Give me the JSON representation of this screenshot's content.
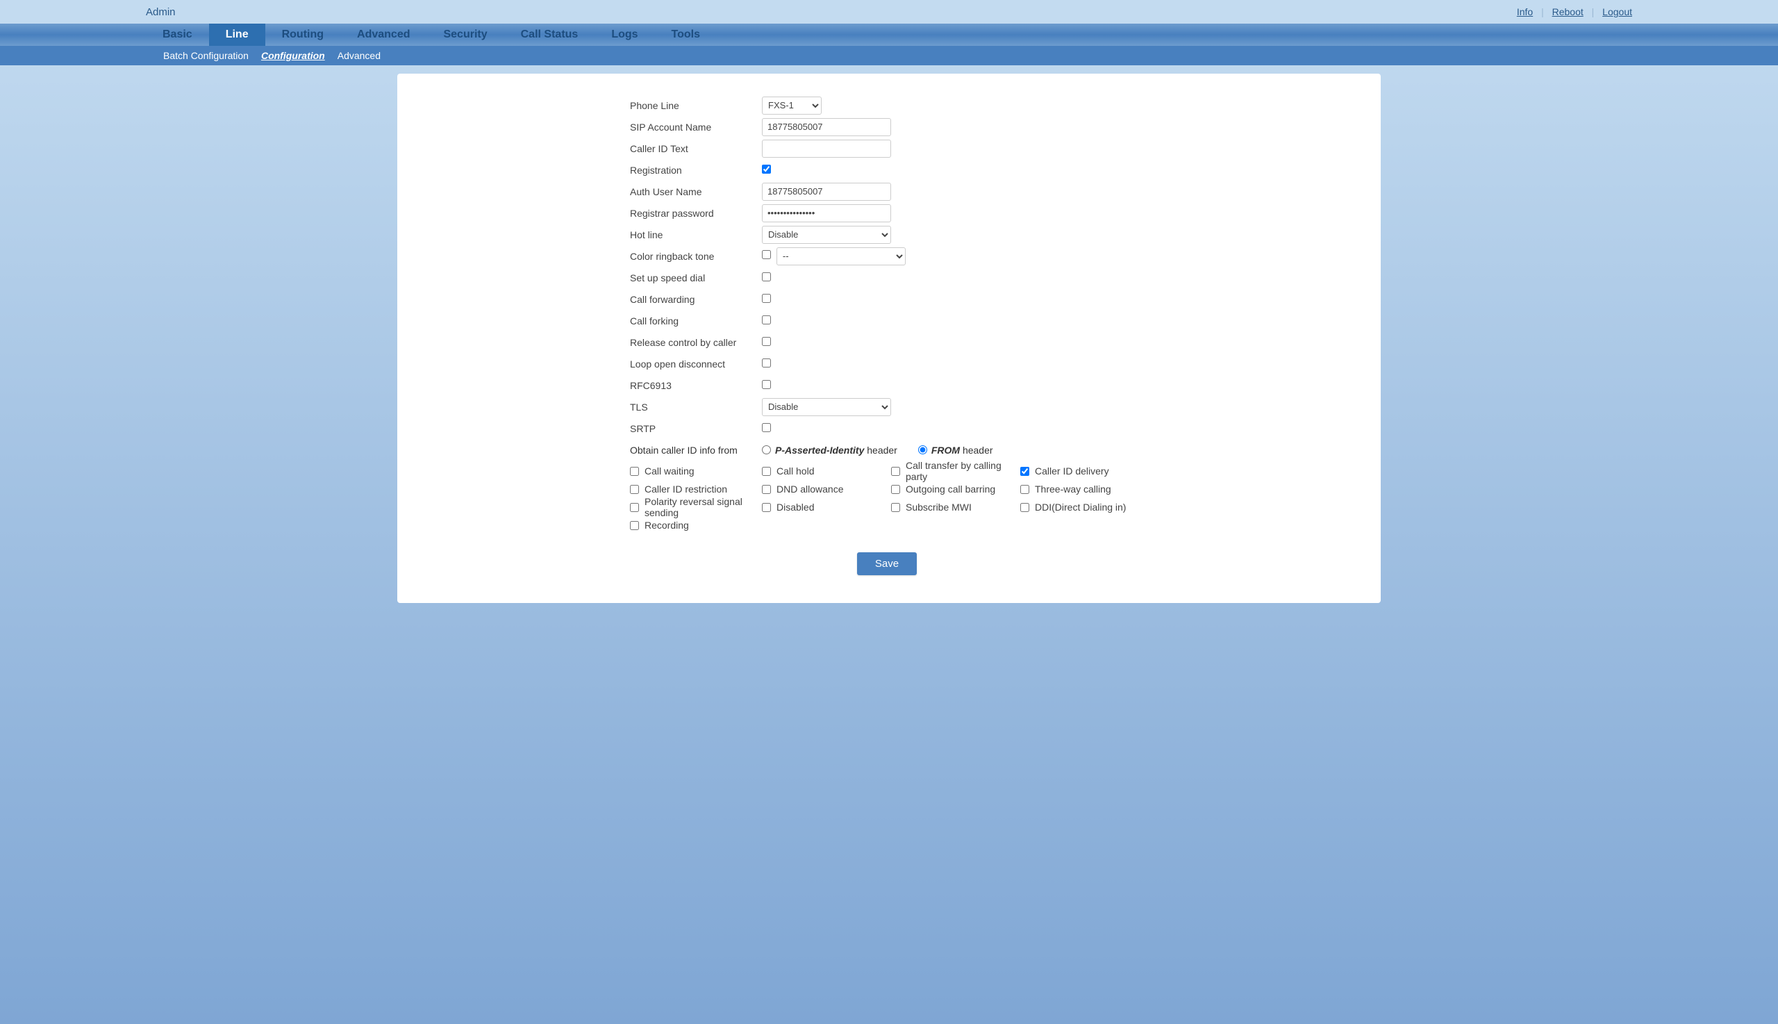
{
  "topbar": {
    "admin": "Admin",
    "info": "Info",
    "reboot": "Reboot",
    "logout": "Logout"
  },
  "nav": {
    "basic": "Basic",
    "line": "Line",
    "routing": "Routing",
    "advanced": "Advanced",
    "security": "Security",
    "callstatus": "Call Status",
    "logs": "Logs",
    "tools": "Tools"
  },
  "subnav": {
    "batch": "Batch Configuration",
    "config": "Configuration",
    "advanced": "Advanced"
  },
  "labels": {
    "phone_line": "Phone Line",
    "sip_account": "SIP Account Name",
    "caller_id_text": "Caller ID Text",
    "registration": "Registration",
    "auth_user": "Auth User Name",
    "reg_password": "Registrar password",
    "hotline": "Hot line",
    "crbt": "Color ringback tone",
    "speed_dial": "Set up speed dial",
    "call_forward": "Call forwarding",
    "call_forking": "Call forking",
    "release_ctrl": "Release control by caller",
    "loop_open": "Loop open disconnect",
    "rfc6913": "RFC6913",
    "tls": "TLS",
    "srtp": "SRTP",
    "obtain": "Obtain caller ID info from"
  },
  "options": {
    "phone_line": "FXS-1",
    "hotline": "Disable",
    "crbt": "--",
    "tls": "Disable",
    "pai1": "P-Asserted-Identity",
    "pai2": " header",
    "from1": "FROM",
    "from2": " header"
  },
  "values": {
    "sip_account": "18775805007",
    "caller_id_text": "",
    "auth_user": "18775805007",
    "reg_password": "•••••••••••••••"
  },
  "features": {
    "call_waiting": "Call waiting",
    "call_hold": "Call hold",
    "call_transfer": "Call transfer by calling party",
    "cid_delivery": "Caller ID delivery",
    "cid_restrict": "Caller ID restriction",
    "dnd": "DND allowance",
    "out_barring": "Outgoing call barring",
    "threeway": "Three-way calling",
    "polarity": "Polarity reversal signal sending",
    "disabled": "Disabled",
    "sub_mwi": "Subscribe MWI",
    "ddi": "DDI(Direct Dialing in)",
    "recording": "Recording"
  },
  "save": "Save"
}
